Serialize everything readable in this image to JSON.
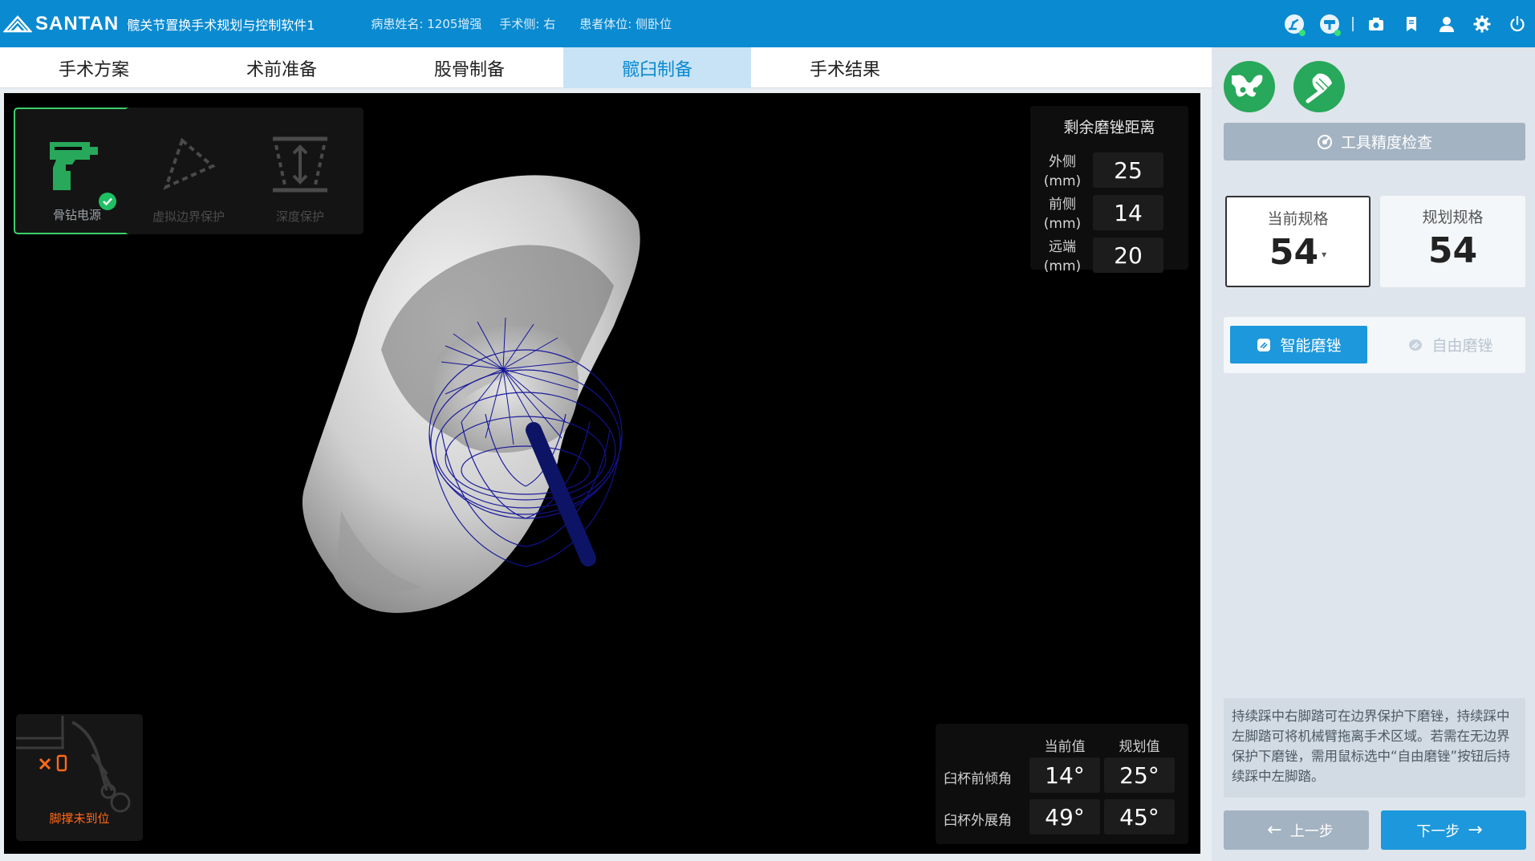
{
  "header": {
    "logo_text": "SANTAN",
    "app_title": "髋关节置换手术规划与控制软件1",
    "patient_name": "病患姓名: 1205增强",
    "surgery_side": "手术侧: 右",
    "patient_position": "患者体位: 侧卧位",
    "icons": [
      "robot-arm-icon",
      "tracker-icon",
      "camera-icon",
      "bookmark-icon",
      "user-icon",
      "settings-icon",
      "power-icon"
    ]
  },
  "tabs": [
    {
      "label": "手术方案",
      "active": false
    },
    {
      "label": "术前准备",
      "active": false
    },
    {
      "label": "股骨制备",
      "active": false
    },
    {
      "label": "髋臼制备",
      "active": true
    },
    {
      "label": "手术结果",
      "active": false
    }
  ],
  "tools": [
    {
      "label": "骨钻电源",
      "state": "active",
      "icon": "drill-icon"
    },
    {
      "label": "虚拟边界保护",
      "state": "disabled",
      "icon": "boundary-icon"
    },
    {
      "label": "深度保护",
      "state": "disabled",
      "icon": "depth-icon"
    }
  ],
  "remaining": {
    "title": "剩余磨锉距离",
    "rows": [
      {
        "label": "外侧",
        "unit": "(mm)",
        "value": "25"
      },
      {
        "label": "前侧",
        "unit": "(mm)",
        "value": "14"
      },
      {
        "label": "远端",
        "unit": "(mm)",
        "value": "20"
      }
    ]
  },
  "angles": {
    "col_current": "当前值",
    "col_planned": "规划值",
    "rows": [
      {
        "label": "臼杯前倾角",
        "current": "14°",
        "planned": "25°"
      },
      {
        "label": "臼杯外展角",
        "current": "49°",
        "planned": "45°"
      }
    ]
  },
  "footrest": {
    "label": "脚撑未到位",
    "color": "#ff6a1a"
  },
  "right_panel": {
    "top_buttons": [
      "pelvis-icon",
      "reamer-icon"
    ],
    "precision_check": "工具精度检查",
    "current_spec": {
      "title": "当前规格",
      "value": "54"
    },
    "planned_spec": {
      "title": "规划规格",
      "value": "54"
    },
    "modes": [
      {
        "label": "智能磨锉",
        "active": true
      },
      {
        "label": "自由磨锉",
        "active": false
      }
    ],
    "note": "持续踩中右脚踏可在边界保护下磨锉，持续踩中左脚踏可将机械臂拖离手术区域。若需在无边界保护下磨锉，需用鼠标选中“自由磨锉”按钮后持续踩中左脚踏。",
    "prev_label": "上一步",
    "next_label": "下一步"
  },
  "colors": {
    "header": "#0a8ad0",
    "accent": "#1d98dc",
    "success": "#27a85a",
    "warning": "#ff6a1a"
  }
}
